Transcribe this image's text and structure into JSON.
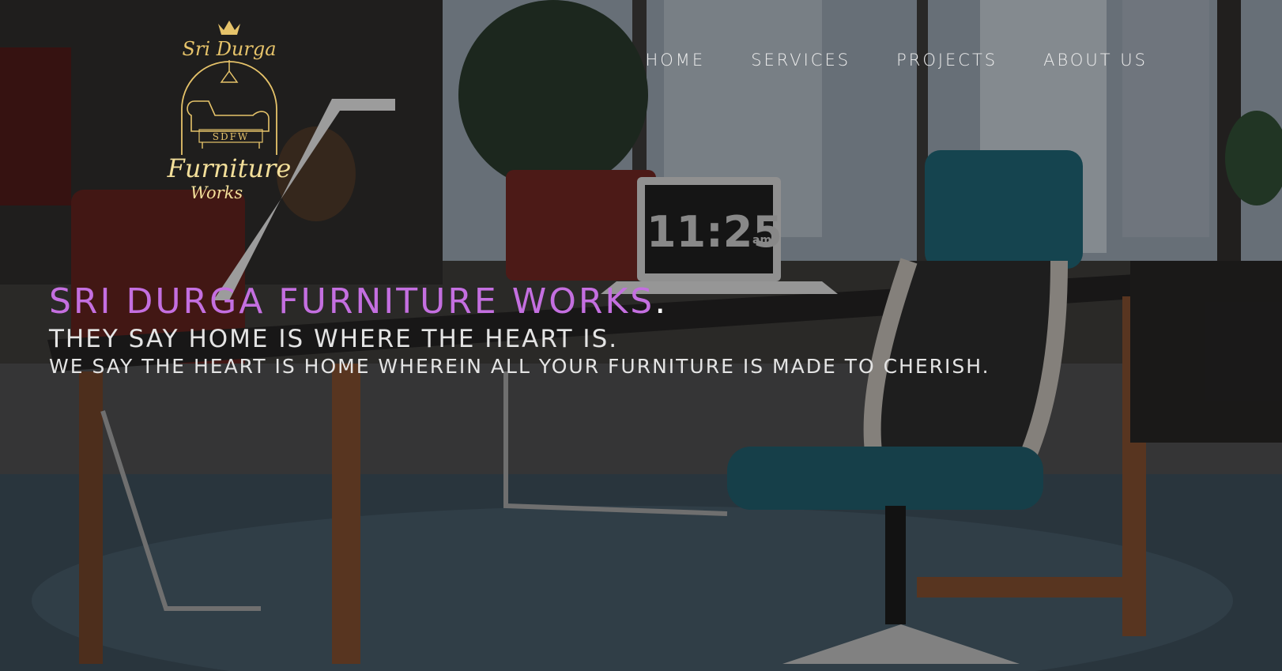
{
  "nav": {
    "home": "HOME",
    "services": "SERVICES",
    "projects": "PROJECTS",
    "about": "ABOUT US"
  },
  "logo": {
    "top_text": "Sri Durga",
    "monogram": "SDFW",
    "main_text": "Furniture",
    "sub_text": "Works",
    "color": "#e6c36a"
  },
  "hero": {
    "title": "SRI DURGA FURNITURE WORKS",
    "title_punct": ".",
    "tagline1": "THEY SAY HOME IS WHERE THE HEART IS.",
    "tagline2": "WE SAY THE HEART IS HOME WHEREIN ALL YOUR FURNITURE IS MADE TO CHERISH.",
    "title_color": "#c46fe0"
  },
  "background": {
    "clock_text": "11:25",
    "clock_suffix": "am"
  }
}
